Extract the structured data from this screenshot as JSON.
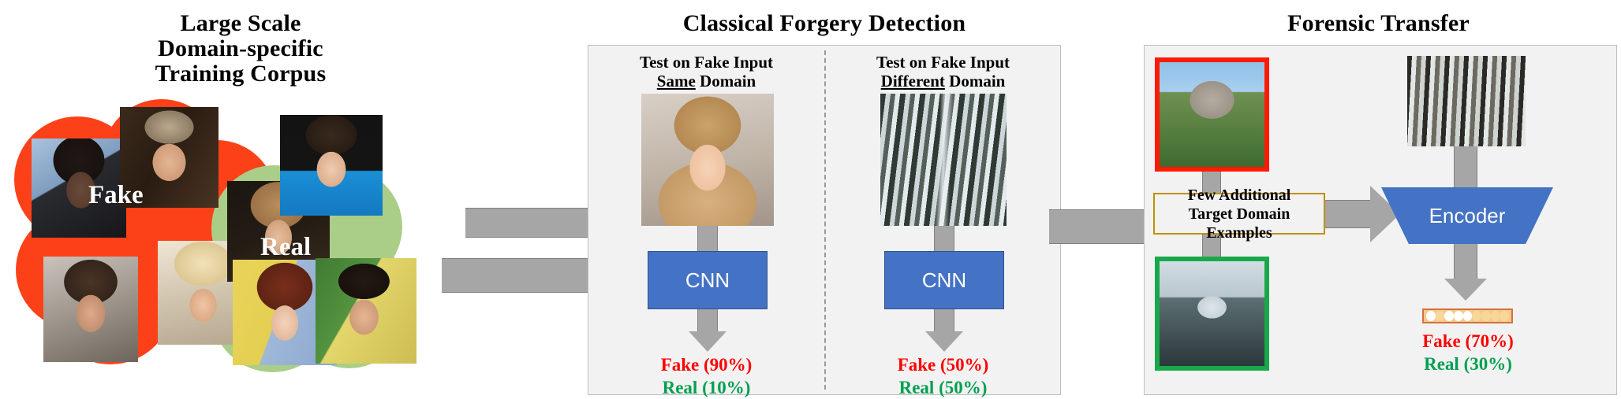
{
  "panels": {
    "corpus": {
      "title": "Large Scale\nDomain-specific\nTraining Corpus",
      "title_lines": [
        "Large Scale",
        "Domain-specific",
        "Training Corpus"
      ],
      "fake_label": "Fake",
      "real_label": "Real",
      "fake_color": "#FC4119",
      "real_color": "#AACE88",
      "thumbnails_fake_count": 5,
      "thumbnails_real_count": 4
    },
    "classical": {
      "title": "Classical Forgery Detection",
      "left": {
        "heading_line1": "Test on Fake Input",
        "heading_emphasis": "Same",
        "heading_line2_rest": " Domain",
        "model_label": "CNN",
        "fake_result": "Fake (90%)",
        "real_result": "Real (10%)",
        "test_image": "portrait-blonde-woman"
      },
      "right": {
        "heading_line1": "Test on Fake Input",
        "heading_emphasis": "Different",
        "heading_line2_rest": " Domain",
        "model_label": "CNN",
        "fake_result": "Fake (50%)",
        "real_result": "Real (50%)",
        "test_image": "snowy-forest-road"
      }
    },
    "forensic": {
      "title": "Forensic Transfer",
      "example_box_label": "Few Additional\nTarget Domain\nExamples",
      "example_box_lines": [
        "Few Additional",
        "Target Domain",
        "Examples"
      ],
      "example_box_border_color": "#BF9000",
      "top_image": "yosemite-valley-trees",
      "top_image_border": "#FF1A00",
      "bottom_image": "snowy-river-forest",
      "bottom_image_border": "#18A84A",
      "target_image": "birch-forest-snow",
      "encoder_label": "Encoder",
      "encoder_color": "#4472C4",
      "fake_result": "Fake (70%)",
      "real_result": "Real (30%)",
      "feature_vector": [
        1,
        0,
        1,
        1,
        1,
        0,
        0,
        0,
        0
      ]
    }
  },
  "colors": {
    "fake_text": "#FF0000",
    "real_text": "#00A050",
    "panel_bg": "#F2F2F2",
    "panel_border": "#BFBFBF",
    "arrow_fill": "#A6A6A6",
    "arrow_stroke": "#808080",
    "cnn_blue": "#4472C4"
  }
}
